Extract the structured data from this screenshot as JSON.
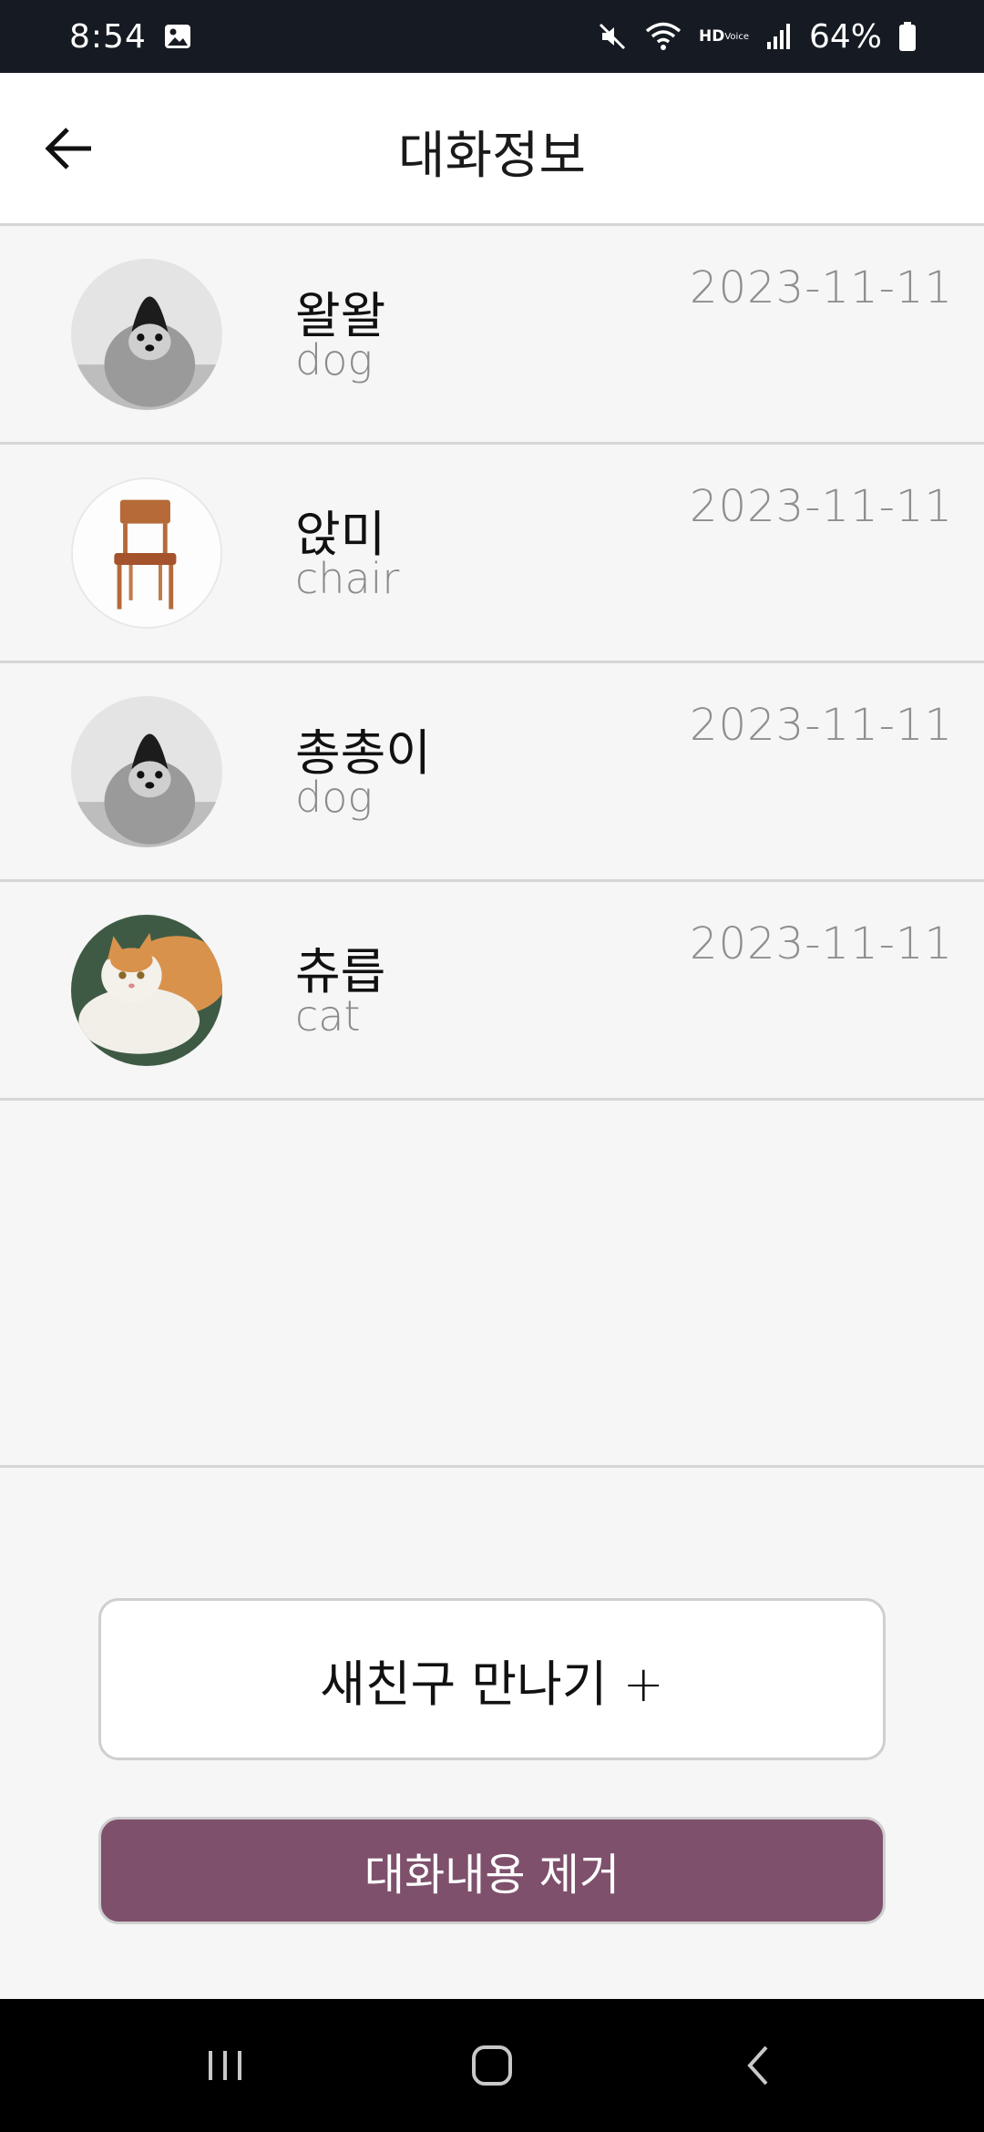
{
  "status_bar": {
    "time": "8:54",
    "battery": "64%",
    "hd_label": "HD",
    "voice_label": "Voice",
    "icons": [
      "image-icon",
      "mute-icon",
      "wifi-icon",
      "hd-voice-icon",
      "signal-icon",
      "battery-icon"
    ]
  },
  "header": {
    "title": "대화정보",
    "back_icon": "arrow-left-icon"
  },
  "chats": [
    {
      "name": "왈왈",
      "kind": "dog",
      "date": "2023-11-11",
      "avatar": "dog-photo"
    },
    {
      "name": "앉미",
      "kind": "chair",
      "date": "2023-11-11",
      "avatar": "chair-photo"
    },
    {
      "name": "총총이",
      "kind": "dog",
      "date": "2023-11-11",
      "avatar": "dog-photo"
    },
    {
      "name": "츄릅",
      "kind": "cat",
      "date": "2023-11-11",
      "avatar": "cat-photo"
    }
  ],
  "actions": {
    "new_friend_label": "새친구 만나기 +",
    "delete_label": "대화내용 제거"
  },
  "colors": {
    "status_bar_bg": "#161a22",
    "accent": "#7e506c",
    "background": "#f6f6f6"
  },
  "nav_bar": {
    "icons": [
      "recent-apps-icon",
      "home-icon",
      "back-icon"
    ]
  }
}
